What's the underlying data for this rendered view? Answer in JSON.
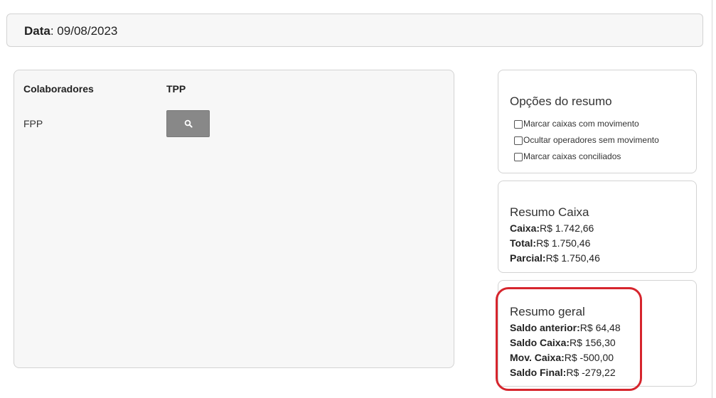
{
  "date_bar": {
    "label": "Data",
    "value": ": 09/08/2023"
  },
  "collaborators": {
    "columns": [
      "Colaboradores",
      "TPP"
    ],
    "rows": [
      {
        "name": "FPP",
        "action_icon": "search-icon"
      }
    ]
  },
  "options": {
    "title": "Opções do resumo",
    "items": [
      {
        "label": "Marcar caixas com movimento",
        "checked": false
      },
      {
        "label": "Ocultar operadores sem movimento",
        "checked": false
      },
      {
        "label": "Marcar caixas conciliados",
        "checked": false
      }
    ]
  },
  "resumo_caixa": {
    "title": "Resumo Caixa",
    "lines": [
      {
        "label": "Caixa:",
        "value": "R$ 1.742,66"
      },
      {
        "label": "Total:",
        "value": "R$ 1.750,46"
      },
      {
        "label": "Parcial:",
        "value": "R$ 1.750,46"
      }
    ]
  },
  "resumo_geral": {
    "title": "Resumo geral",
    "lines": [
      {
        "label": "Saldo anterior:",
        "value": "R$ 64,48"
      },
      {
        "label": "Saldo Caixa:",
        "value": "R$ 156,30"
      },
      {
        "label": "Mov. Caixa:",
        "value": "R$ -500,00"
      },
      {
        "label": "Saldo Final:",
        "value": "R$ -279,22"
      }
    ]
  },
  "colors": {
    "highlight": "#d6252d",
    "button": "#888888",
    "panel_bg": "#f7f7f7",
    "border": "#d3d3d3"
  }
}
